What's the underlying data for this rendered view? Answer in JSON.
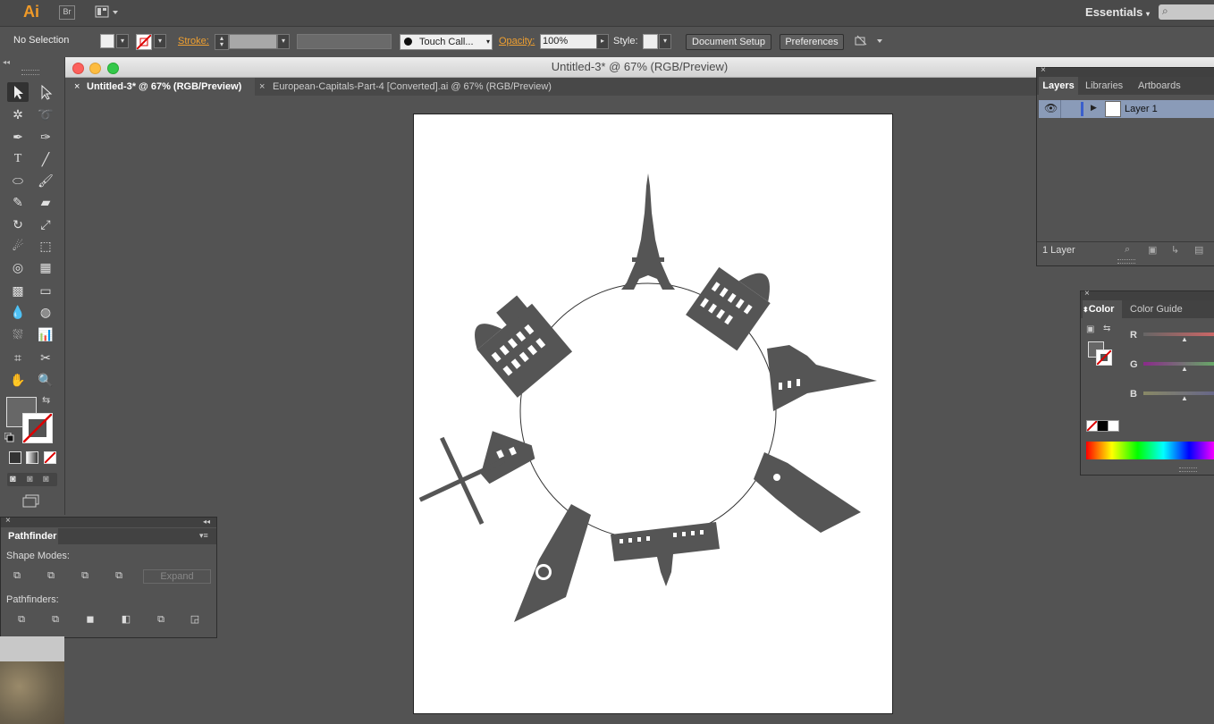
{
  "app": {
    "logo": "Ai",
    "bridge": "Br",
    "workspace": "Essentials",
    "arrange_icon": "arrange-documents-icon"
  },
  "control_bar": {
    "selection": "No Selection",
    "stroke_label": "Stroke:",
    "brush": "Touch Call...",
    "opacity_label": "Opacity:",
    "opacity_value": "100%",
    "style_label": "Style:",
    "document_setup": "Document Setup",
    "preferences": "Preferences"
  },
  "document": {
    "window_title": "Untitled-3* @ 67% (RGB/Preview)",
    "tabs": [
      {
        "label": "Untitled-3* @ 67% (RGB/Preview)",
        "active": true
      },
      {
        "label": "European-Capitals-Part-4 [Converted].ai @ 67% (RGB/Preview)",
        "active": false
      }
    ]
  },
  "layers_panel": {
    "tabs": [
      "Layers",
      "Libraries",
      "Artboards"
    ],
    "layer_name": "Layer 1",
    "count": "1 Layer"
  },
  "color_panel": {
    "tabs": [
      "Color",
      "Color Guide"
    ],
    "channels": [
      "R",
      "G",
      "B"
    ]
  },
  "pathfinder_panel": {
    "title": "Pathfinder",
    "shape_modes_label": "Shape Modes:",
    "expand": "Expand",
    "pathfinders_label": "Pathfinders:"
  },
  "colors": {
    "ui_bg": "#535353",
    "accent": "#f09a28",
    "layer_selected": "#8a9bb8",
    "artwork": "#555555"
  }
}
